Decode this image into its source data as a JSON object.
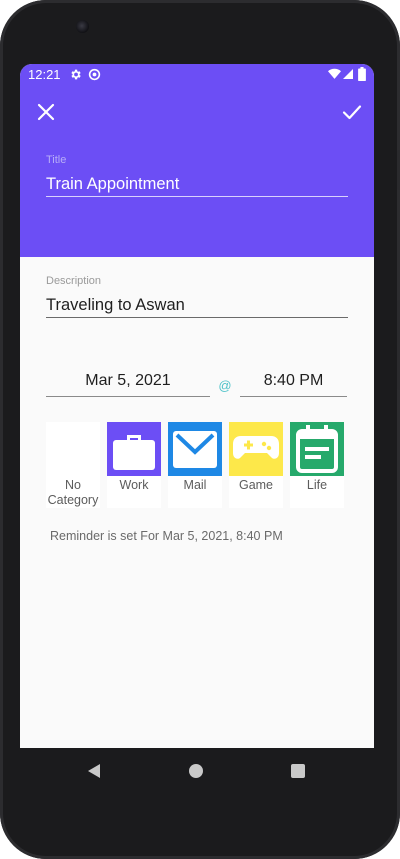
{
  "status_bar": {
    "time": "12:21",
    "icons": [
      "gear-icon",
      "sync-icon",
      "wifi-icon",
      "signal-icon",
      "battery-icon"
    ]
  },
  "app_bar": {
    "close_icon": "close-icon",
    "save_icon": "check-icon"
  },
  "form": {
    "title_label": "Title",
    "title_value": "Train Appointment",
    "description_label": "Description",
    "description_value": "Traveling to Aswan",
    "date_value": "Mar 5, 2021",
    "at_symbol": "@",
    "time_value": "8:40 PM"
  },
  "categories": [
    {
      "name": "no-category",
      "label_line1": "No",
      "label_line2": "Category",
      "color": "#ffffff",
      "icon": ""
    },
    {
      "name": "work",
      "label": "Work",
      "color": "#6c4ef5",
      "icon": "briefcase-icon"
    },
    {
      "name": "mail",
      "label": "Mail",
      "color": "#1e88e5",
      "icon": "mail-icon"
    },
    {
      "name": "game",
      "label": "Game",
      "color": "#fde84a",
      "icon": "gamepad-icon"
    },
    {
      "name": "life",
      "label": "Life",
      "color": "#26a96b",
      "icon": "calendar-icon"
    }
  ],
  "reminder_text": "Reminder is set For Mar 5, 2021, 8:40 PM",
  "navigation": {
    "back_icon": "back-icon",
    "home_icon": "home-icon",
    "recents_icon": "recents-icon"
  },
  "colors": {
    "header": "#6c4ef5",
    "accent_at": "#4fc3c9",
    "background": "#fafafa",
    "phone_body": "#1b1b1d"
  }
}
